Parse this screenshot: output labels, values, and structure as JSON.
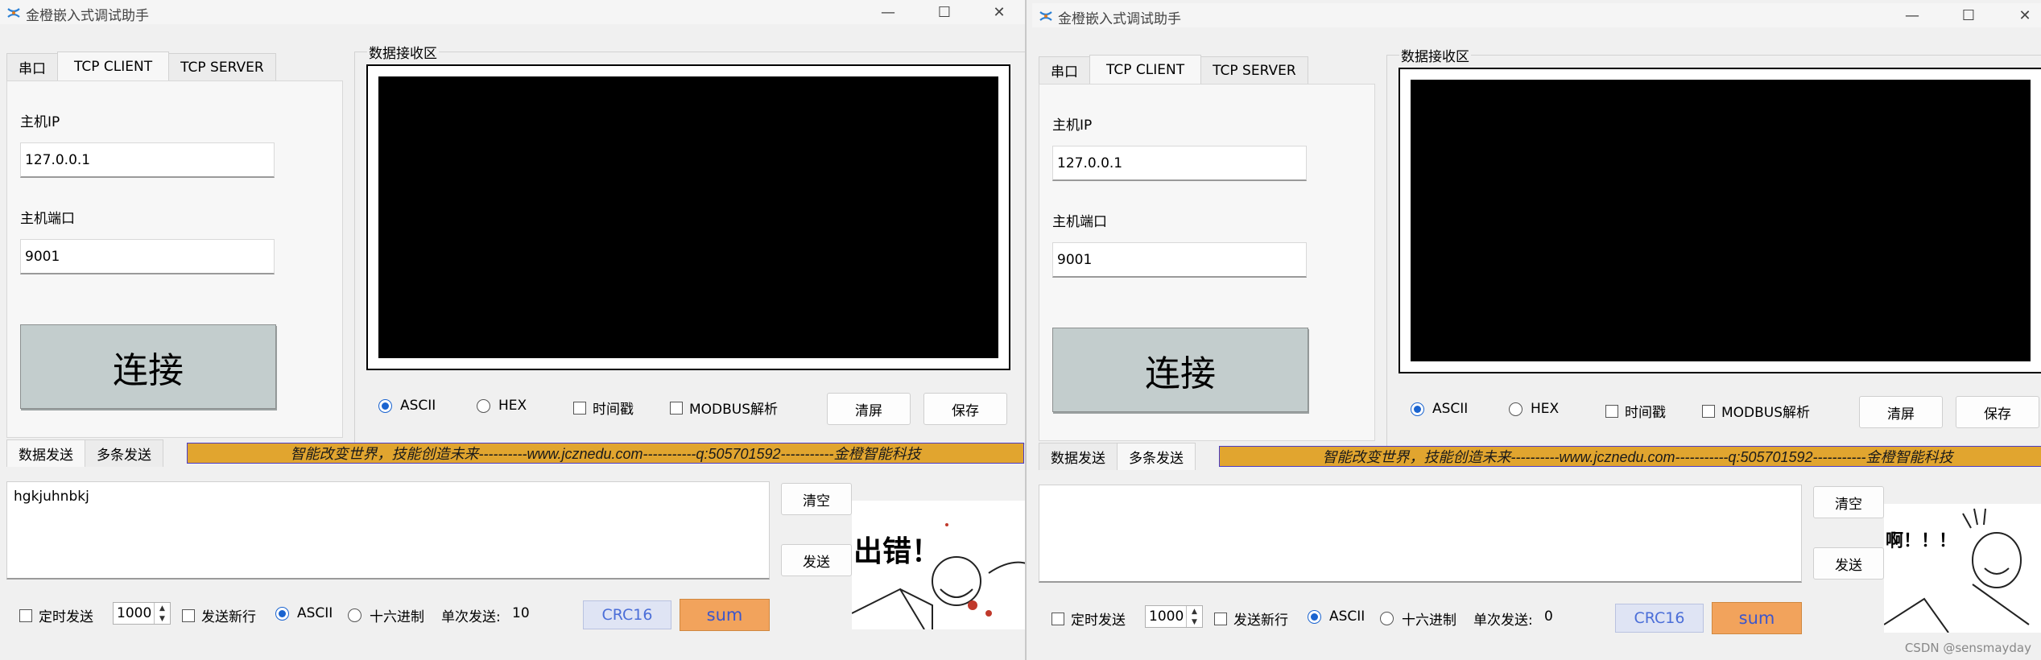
{
  "app": {
    "title": "金橙嵌入式调试助手"
  },
  "top_tabs": [
    "串口",
    "TCP CLIENT",
    "TCP SERVER"
  ],
  "tcp": {
    "host_ip_label": "主机IP",
    "host_ip_value": "127.0.0.1",
    "host_port_label": "主机端口",
    "host_port_value": "9001",
    "connect_label": "连接"
  },
  "receive": {
    "group_label": "数据接收区",
    "options": {
      "ascii": "ASCII",
      "hex": "HEX",
      "timestamp": "时间戳",
      "modbus": "MODBUS解析"
    },
    "clear_label": "清屏",
    "save_label": "保存"
  },
  "send_tabs": [
    "数据发送",
    "多条发送"
  ],
  "banner": "智能改变世界，技能创造未来----------www.jcznedu.com-----------q:505701592-----------金橙智能科技",
  "send": {
    "clear_label": "清空",
    "send_label": "发送",
    "timed_send_label": "定时发送",
    "interval_value": "1000",
    "newline_label": "发送新行",
    "ascii_label": "ASCII",
    "hex_label": "十六进制",
    "single_send_label": "单次发送:",
    "crc_label": "CRC16",
    "sum_label": "sum"
  },
  "windows": [
    {
      "send_text": "hgkjuhnbkj",
      "single_send_count": "10",
      "meme_caption": "出错！"
    },
    {
      "send_text": "",
      "single_send_count": "0",
      "meme_caption": "啊！！！"
    }
  ],
  "watermark": "CSDN @sensmayday",
  "colors": {
    "banner_bg": "#e1a52f",
    "connect_bg": "#c3cdcd",
    "sum_bg": "#f2a35c",
    "crc_bg": "#dfe4f4",
    "radio_accent": "#1a64d0"
  }
}
